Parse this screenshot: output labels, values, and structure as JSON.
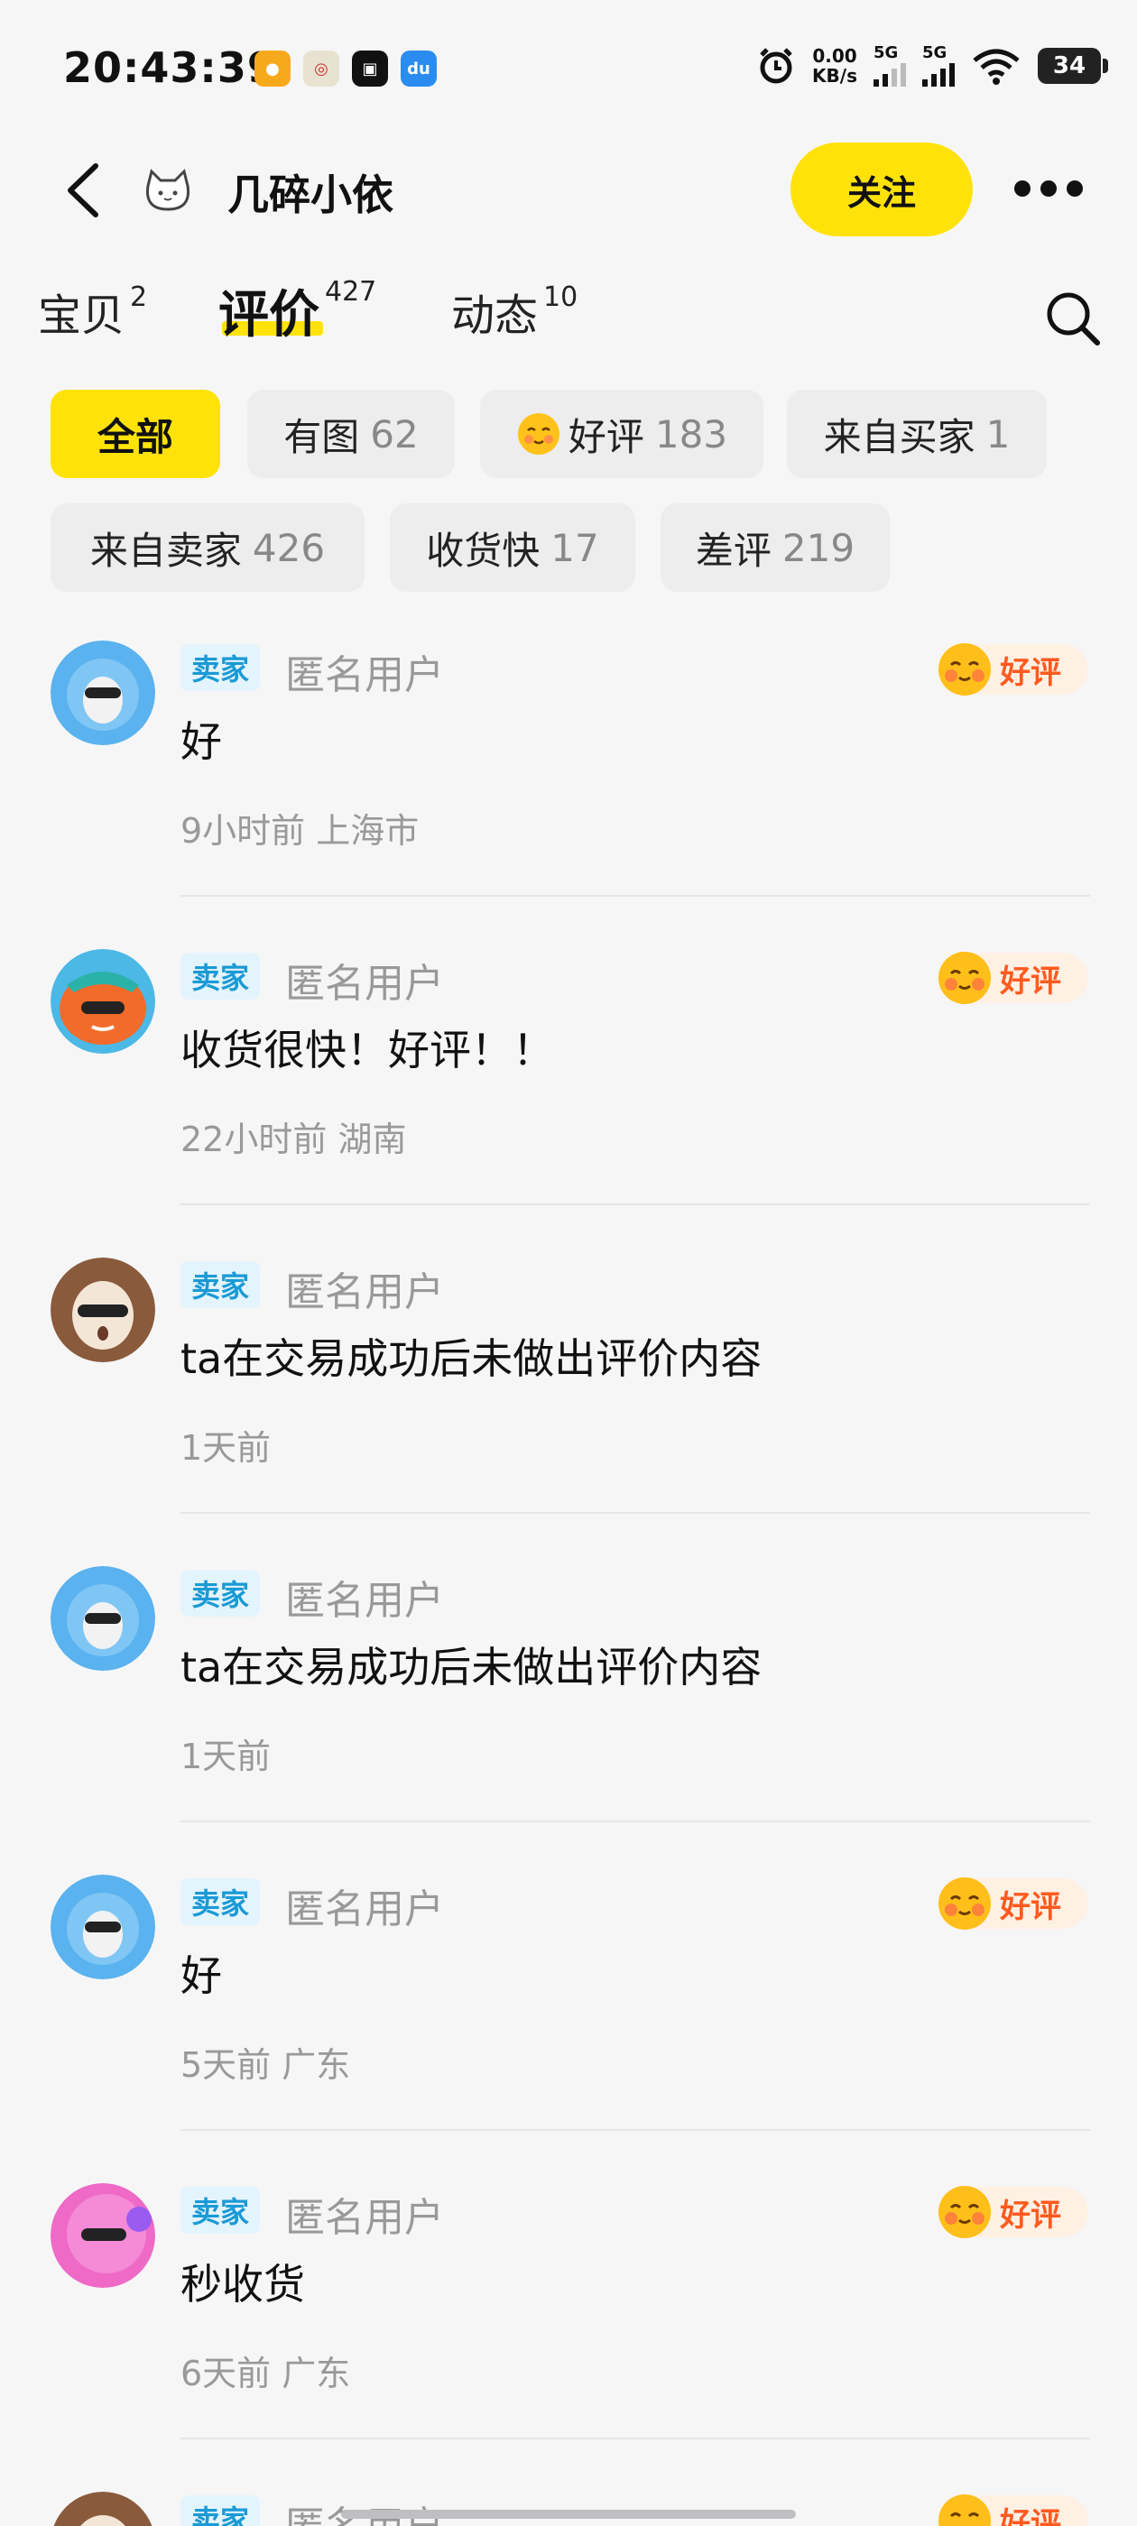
{
  "status_bar": {
    "time": "20:43:39",
    "net_speed_value": "0.00",
    "net_speed_unit": "KB/s",
    "sig1_label": "5G",
    "sig2_label": "5G",
    "battery": "34"
  },
  "header": {
    "shop_name": "几碎小依",
    "follow_label": "关注"
  },
  "tabs": [
    {
      "label": "宝贝",
      "count": "2"
    },
    {
      "label": "评价",
      "count": "427",
      "active": true
    },
    {
      "label": "动态",
      "count": "10"
    }
  ],
  "filters": [
    {
      "label": "全部",
      "count": "",
      "active": true
    },
    {
      "label": "有图",
      "count": "62"
    },
    {
      "label": "好评",
      "count": "183",
      "emoji": "smile-emoji-icon"
    },
    {
      "label": "来自买家",
      "count": "1"
    },
    {
      "label": "来自卖家",
      "count": "426"
    },
    {
      "label": "收货快",
      "count": "17"
    },
    {
      "label": "差评",
      "count": "219"
    }
  ],
  "good_badge_label": "好评",
  "reviews": [
    {
      "role": "卖家",
      "user": "匿名用户",
      "good": true,
      "content": "好",
      "time": "9小时前",
      "location": "上海市",
      "avatar": "blue-fluffy-avatar"
    },
    {
      "role": "卖家",
      "user": "匿名用户",
      "good": true,
      "content": "收货很快！好评！！",
      "time": "22小时前",
      "location": "湖南",
      "avatar": "orange-avatar"
    },
    {
      "role": "卖家",
      "user": "匿名用户",
      "good": false,
      "content": "ta在交易成功后未做出评价内容",
      "time": "1天前",
      "location": "",
      "avatar": "brown-avatar"
    },
    {
      "role": "卖家",
      "user": "匿名用户",
      "good": false,
      "content": "ta在交易成功后未做出评价内容",
      "time": "1天前",
      "location": "",
      "avatar": "blue-fluffy-avatar"
    },
    {
      "role": "卖家",
      "user": "匿名用户",
      "good": true,
      "content": "好",
      "time": "5天前",
      "location": "广东",
      "avatar": "blue-fluffy-avatar"
    },
    {
      "role": "卖家",
      "user": "匿名用户",
      "good": true,
      "content": "秒收货",
      "time": "6天前",
      "location": "广东",
      "avatar": "pink-avatar"
    },
    {
      "role": "卖家",
      "user": "匿名用户",
      "good": true,
      "content": "",
      "time": "",
      "location": "",
      "avatar": "brown-avatar"
    }
  ],
  "colors": {
    "accent_yellow": "#ffe20a",
    "seller_badge_bg": "#e4f4fc",
    "seller_badge_text": "#1a9ad6",
    "good_badge_text": "#ff5a1f"
  }
}
